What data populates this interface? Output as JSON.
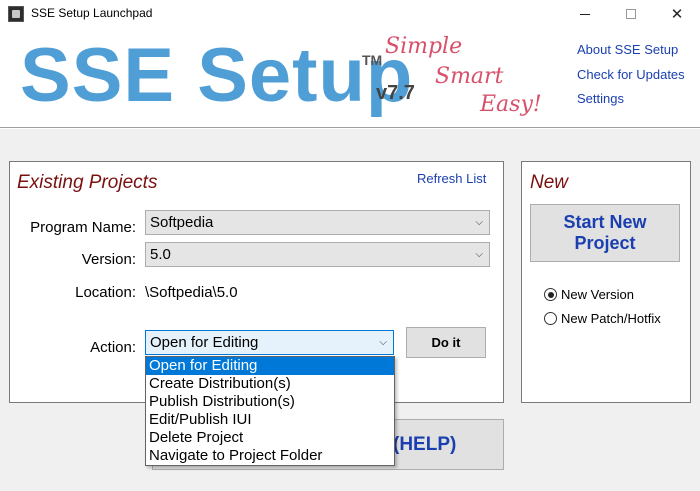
{
  "window": {
    "title": "SSE Setup Launchpad",
    "controls": {
      "minimize": "",
      "maximize": "",
      "close": "✕"
    }
  },
  "header": {
    "logo_text": "SSE Setup",
    "logo_tm": "TM",
    "version": "v7.7",
    "tagline": [
      "Simple",
      "Smart",
      "Easy!"
    ],
    "links": {
      "about": "About SSE Setup",
      "updates": "Check for Updates",
      "settings": "Settings"
    }
  },
  "existing": {
    "title": "Existing Projects",
    "refresh": "Refresh List",
    "program_label": "Program Name:",
    "program_value": "Softpedia",
    "version_label": "Version:",
    "version_value": "5.0",
    "location_label": "Location:",
    "location_value": "\\Softpedia\\5.0",
    "action_label": "Action:",
    "action_value": "Open for Editing",
    "doit": "Do it",
    "action_options": [
      "Open for Editing",
      "Create Distribution(s)",
      "Publish Distribution(s)",
      "Edit/Publish IUI",
      "Delete Project",
      "Navigate to Project Folder"
    ],
    "selected_index": 0
  },
  "help_button": {
    "label": "(HELP)"
  },
  "new_panel": {
    "title": "New",
    "start_button": "Start New Project",
    "radio_new_version": "New Version",
    "radio_new_patch": "New Patch/Hotfix",
    "selected": "New Version"
  },
  "colors": {
    "logo_blue": "#4f9ed6",
    "link_blue": "#1a3fb0",
    "section_title": "#7a1010",
    "tagline_pink": "#d8506a",
    "highlight": "#0078d7"
  },
  "icons": {
    "app": "app-icon",
    "combo_arrow": "chevron-down-icon"
  }
}
